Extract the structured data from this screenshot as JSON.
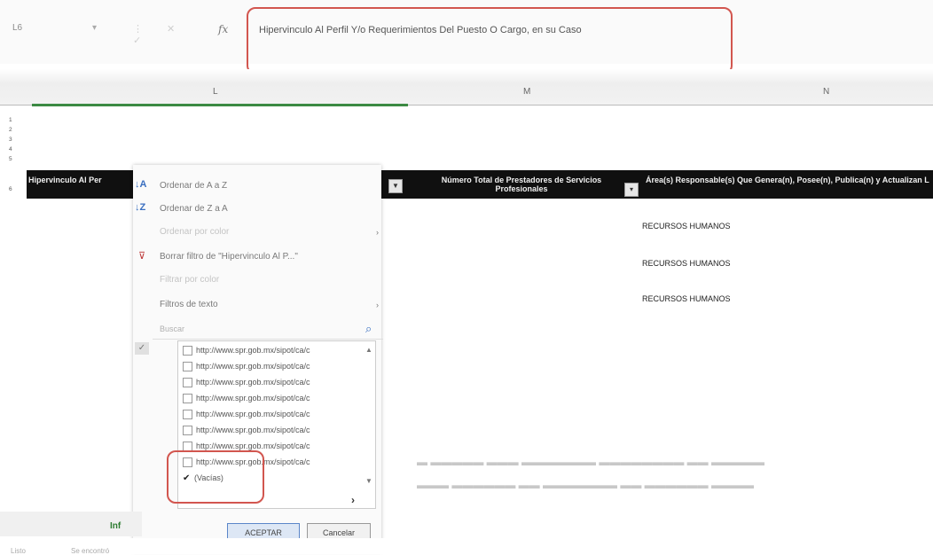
{
  "formula_bar": {
    "name_box": "L6",
    "fx": "fx",
    "formula": "Hipervinculo Al Perfil Y/o Requerimientos Del Puesto O Cargo, en su Caso"
  },
  "columns": {
    "L": "L",
    "M": "M",
    "N": "N"
  },
  "row_numbers": [
    "1",
    "2",
    "3",
    "4",
    "5",
    "6"
  ],
  "header": {
    "col_l": "Hipervinculo Al Per",
    "col_m": "Número Total de Prestadores de Servicios Profesionales",
    "col_n": "Área(s) Responsable(s) Que Genera(n), Posee(n), Publica(n) y Actualizan La Información"
  },
  "cells": [
    "RECURSOS HUMANOS",
    "RECURSOS HUMANOS",
    "RECURSOS HUMANOS"
  ],
  "filter_menu": {
    "sort_az": "Ordenar de A a Z",
    "sort_za": "Ordenar de Z a A",
    "sort_color": "Ordenar por color",
    "clear_filter": "Borrar filtro de \"Hipervinculo Al P...\"",
    "filter_color": "Filtrar por color",
    "text_filters": "Filtros de texto",
    "search_placeholder": "Buscar",
    "items": [
      "http://www.spr.gob.mx/sipot/ca/c",
      "http://www.spr.gob.mx/sipot/ca/c",
      "http://www.spr.gob.mx/sipot/ca/c",
      "http://www.spr.gob.mx/sipot/ca/c",
      "http://www.spr.gob.mx/sipot/ca/c",
      "http://www.spr.gob.mx/sipot/ca/c",
      "http://www.spr.gob.mx/sipot/ca/c",
      "http://www.spr.gob.mx/sipot/ca/c"
    ],
    "blanks": "(Vacías)",
    "accept": "ACEPTAR",
    "cancel": "Cancelar"
  },
  "sheet_tab": "Inf",
  "status": {
    "mode": "Listo",
    "message": "Se encontró"
  },
  "colors": {
    "highlight_red": "#d2564f",
    "header_black": "#101010",
    "selection_green": "#3c8a43"
  }
}
